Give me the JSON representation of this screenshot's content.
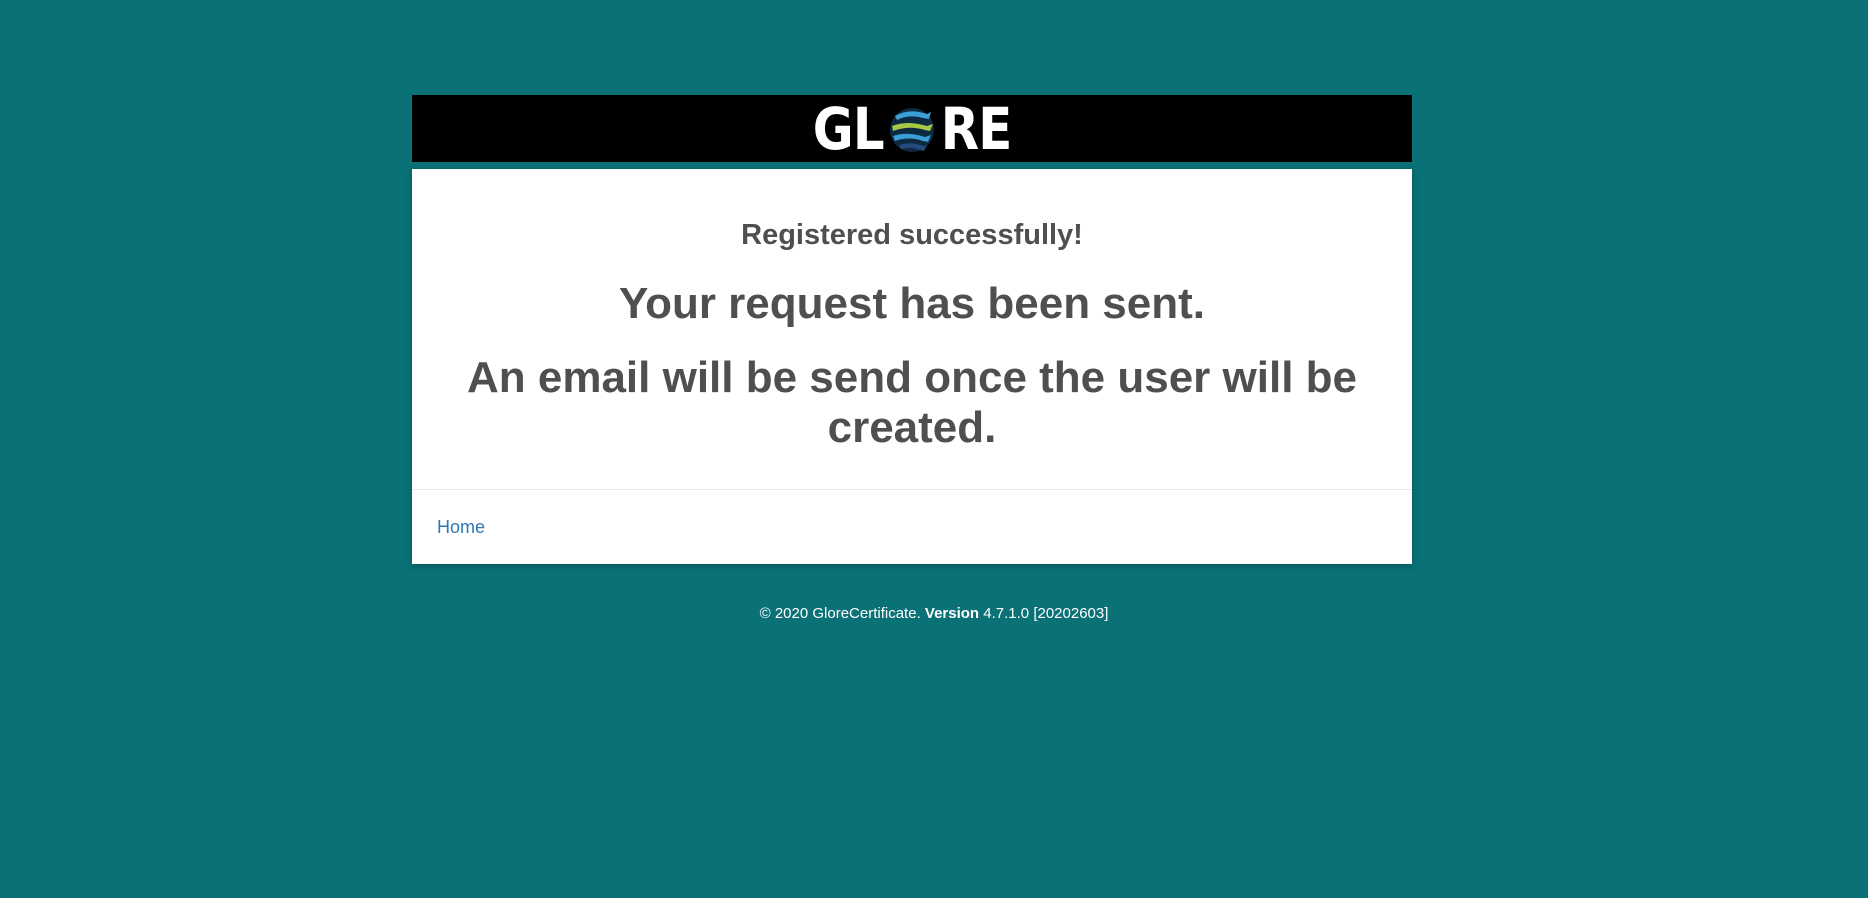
{
  "brand": {
    "logo_text_left": "GL",
    "logo_text_right": "RE",
    "colors": {
      "background": "#0a7177",
      "bar": "#000000",
      "globe_blue": "#3a9fd6",
      "globe_green": "#a6c945",
      "globe_navy": "#264a7c"
    }
  },
  "message": {
    "subtitle": "Registered successfully!",
    "line1": "Your request has been sent.",
    "line2": "An email will be send once the user will be created."
  },
  "footer_nav": {
    "home_label": "Home"
  },
  "page_footer": {
    "copyright": "© 2020 GloreCertificate. ",
    "version_label": "Version",
    "version_value": " 4.7.1.0 [20202603]"
  }
}
